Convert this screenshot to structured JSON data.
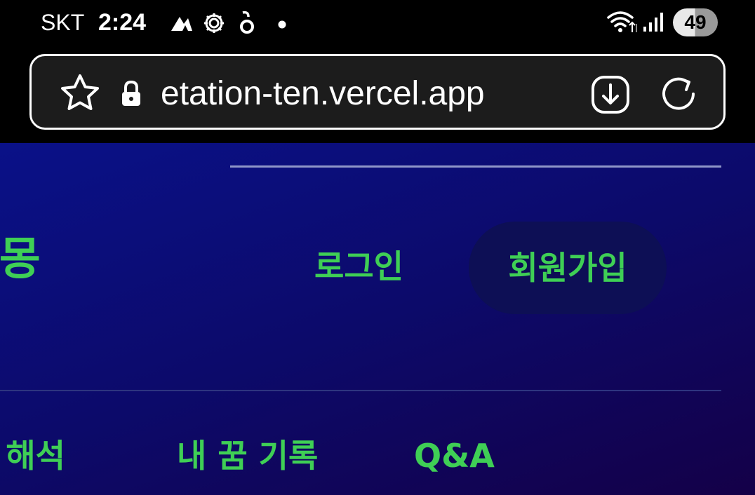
{
  "status_bar": {
    "carrier": "SKT",
    "time": "2:24",
    "notification_icons": [
      "threads-icon",
      "settings-gear-icon",
      "app-notification-icon",
      "dot-icon"
    ],
    "system_icons": [
      "wifi-icon",
      "signal-icon"
    ],
    "battery": "49"
  },
  "browser": {
    "url": "etation-ten.vercel.app",
    "icons": [
      "star-icon",
      "lock-icon",
      "download-icon",
      "reload-icon"
    ]
  },
  "site": {
    "brand": "해몽",
    "login_label": "로그인",
    "signup_label": "회원가입",
    "nav": [
      {
        "label": "꿈 해석"
      },
      {
        "label": "내 꿈 기록"
      },
      {
        "label": "Q&A"
      }
    ],
    "colors": {
      "accent_green": "#3fcf55",
      "background_blue": "#0a1188",
      "background_purple": "#140048"
    }
  }
}
